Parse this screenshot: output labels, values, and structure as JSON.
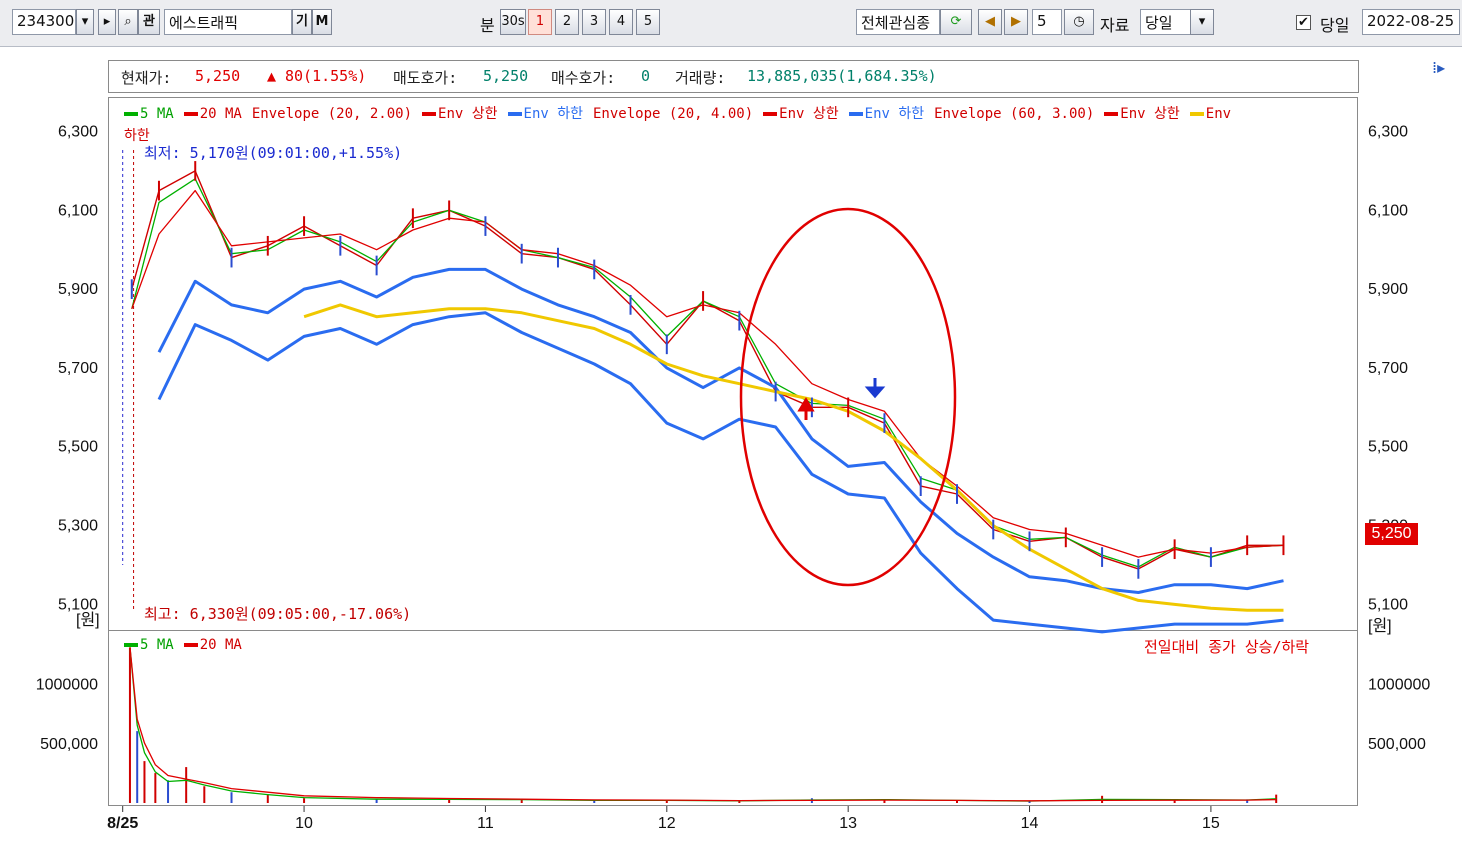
{
  "toolbar": {
    "code": "234300",
    "name": "에스트래픽",
    "ki_btn": "기",
    "m_btn": "M",
    "gwan_btn": "관",
    "bun_label": "분",
    "sec_btn": "30s",
    "periods": [
      "1",
      "2",
      "3",
      "4",
      "5"
    ],
    "watch_list": "전체관심종",
    "count": "5",
    "data_label": "자료",
    "range_select": "당일",
    "today_label": "당일",
    "date": "2022-08-25",
    "today_checked": true
  },
  "info": {
    "cur_label": "현재가:",
    "cur_price": "5,250",
    "change_arrow": "▲",
    "change": "80(1.55%)",
    "ask_label": "매도호가:",
    "ask": "5,250",
    "bid_label": "매수호가:",
    "bid": "0",
    "vol_label": "거래량:",
    "volume": "13,885,035(1,684.35%)"
  },
  "legend_price": [
    {
      "text": "5 MA",
      "color": "#00b000"
    },
    {
      "text": "20 MA",
      "color": "#e00000"
    },
    {
      "text": "Envelope (20, 2.00)",
      "color": "#d00000",
      "noswatch": true
    },
    {
      "text": "Env 상한",
      "color": "#e00000"
    },
    {
      "text": "Env 하한",
      "color": "#2a6cf0"
    },
    {
      "text": "Envelope (20, 4.00)",
      "color": "#d00000",
      "noswatch": true
    },
    {
      "text": "Env 상한",
      "color": "#e00000"
    },
    {
      "text": "Env 하한",
      "color": "#2a6cf0"
    },
    {
      "text": "Envelope (60, 3.00)",
      "color": "#d00000",
      "noswatch": true
    },
    {
      "text": "Env 상한",
      "color": "#e00000"
    },
    {
      "text": "Env 하한",
      "color": "#f0c800"
    }
  ],
  "annotations": {
    "low": "최저: 5,170원(09:01:00,+1.55%)",
    "high": "최고: 6,330원(09:05:00,-17.06%)",
    "volume_note": "전일대비 종가 상승/하락",
    "current_badge": "5,250",
    "unit": "[원]"
  },
  "legend_volume": [
    {
      "text": "5 MA",
      "color": "#00b000"
    },
    {
      "text": "20 MA",
      "color": "#e00000"
    }
  ],
  "chart_data": {
    "type": "line",
    "title": "",
    "x": [
      9.05,
      9.2,
      9.4,
      9.6,
      9.8,
      10.0,
      10.2,
      10.4,
      10.6,
      10.8,
      11.0,
      11.2,
      11.4,
      11.6,
      11.8,
      12.0,
      12.2,
      12.4,
      12.6,
      12.8,
      13.0,
      13.2,
      13.4,
      13.6,
      13.8,
      14.0,
      14.2,
      14.4,
      14.6,
      14.8,
      15.0,
      15.2,
      15.4
    ],
    "x_ticks": [
      "8/25",
      "10",
      "11",
      "12",
      "13",
      "14",
      "15"
    ],
    "x_tick_values": [
      9.0,
      10.0,
      11.0,
      12.0,
      13.0,
      14.0,
      15.0
    ],
    "xlim": [
      8.93,
      15.8
    ],
    "ylim": [
      5040,
      6380
    ],
    "y_ticks": [
      "6,300",
      "6,100",
      "5,900",
      "5,700",
      "5,500",
      "5,300",
      "5,100"
    ],
    "y_tick_values": [
      6300,
      6100,
      5900,
      5700,
      5500,
      5300,
      5100
    ],
    "series": [
      {
        "name": "Price",
        "color": "#d00000",
        "values": [
          5900,
          6150,
          6200,
          5980,
          6010,
          6060,
          6010,
          5960,
          6080,
          6100,
          6060,
          5990,
          5980,
          5950,
          5860,
          5760,
          5870,
          5820,
          5640,
          5600,
          5600,
          5560,
          5400,
          5380,
          5290,
          5260,
          5270,
          5220,
          5190,
          5240,
          5220,
          5250,
          5250
        ]
      },
      {
        "name": "5 MA",
        "color": "#00b000",
        "values": [
          5850,
          6120,
          6180,
          5990,
          6000,
          6050,
          6020,
          5970,
          6070,
          6100,
          6070,
          6000,
          5980,
          5955,
          5880,
          5780,
          5870,
          5830,
          5660,
          5610,
          5605,
          5570,
          5420,
          5390,
          5300,
          5265,
          5270,
          5225,
          5195,
          5245,
          5220,
          5245,
          5250
        ]
      },
      {
        "name": "20 MA",
        "color": "#e00000",
        "values": [
          5850,
          6040,
          6150,
          6010,
          6020,
          6030,
          6040,
          6000,
          6050,
          6080,
          6070,
          6000,
          5990,
          5960,
          5910,
          5830,
          5860,
          5840,
          5760,
          5660,
          5620,
          5590,
          5470,
          5400,
          5320,
          5290,
          5280,
          5250,
          5220,
          5240,
          5230,
          5245,
          5250
        ]
      },
      {
        "name": "Env 하한 (20, 2.00)",
        "color": "#2a6cf0",
        "values": [
          null,
          5740,
          5920,
          5860,
          5840,
          5900,
          5920,
          5880,
          5930,
          5950,
          5950,
          5900,
          5860,
          5830,
          5790,
          5700,
          5650,
          5700,
          5650,
          5520,
          5450,
          5460,
          5360,
          5280,
          5220,
          5170,
          5160,
          5140,
          5130,
          5150,
          5150,
          5140,
          5160
        ]
      },
      {
        "name": "Env 하한 (20, 4.00)",
        "color": "#2a6cf0",
        "values": [
          null,
          5620,
          5810,
          5770,
          5720,
          5780,
          5800,
          5760,
          5810,
          5830,
          5840,
          5790,
          5750,
          5710,
          5660,
          5560,
          5520,
          5570,
          5550,
          5430,
          5380,
          5370,
          5230,
          5140,
          5060,
          5050,
          5040,
          5030,
          5040,
          5050,
          5050,
          5050,
          5060
        ]
      },
      {
        "name": "Env 하한 (60, 3.00)",
        "color": "#f0c800",
        "values": [
          null,
          null,
          null,
          null,
          null,
          5830,
          5860,
          5830,
          5840,
          5850,
          5850,
          5840,
          5820,
          5800,
          5760,
          5710,
          5680,
          5660,
          5640,
          5620,
          5590,
          5540,
          5470,
          5390,
          5300,
          5240,
          5190,
          5140,
          5110,
          5100,
          5090,
          5085,
          5085
        ]
      }
    ],
    "volume": {
      "ylim": [
        0,
        1420000
      ],
      "y_ticks": [
        "1000000",
        "500,000"
      ],
      "y_tick_values": [
        1000000,
        500000
      ],
      "x": [
        9.04,
        9.08,
        9.12,
        9.18,
        9.25,
        9.35,
        9.45,
        9.6,
        9.8,
        10.0,
        10.4,
        10.8,
        11.2,
        11.6,
        12.0,
        12.4,
        12.8,
        13.2,
        13.6,
        14.0,
        14.4,
        14.8,
        15.2,
        15.36
      ],
      "values": [
        1300000,
        600000,
        350000,
        250000,
        190000,
        300000,
        140000,
        90000,
        70000,
        40000,
        30000,
        35000,
        25000,
        20000,
        25000,
        15000,
        40000,
        30000,
        20000,
        15000,
        60000,
        20000,
        30000,
        70000
      ],
      "ma5": [
        1300000,
        650000,
        420000,
        260000,
        180000,
        190000,
        150000,
        100000,
        70000,
        45000,
        32000,
        30000,
        28000,
        22000,
        22000,
        18000,
        25000,
        28000,
        22000,
        16000,
        30000,
        28000,
        25000,
        35000
      ],
      "ma20": [
        1300000,
        700000,
        500000,
        320000,
        230000,
        200000,
        170000,
        120000,
        90000,
        60000,
        45000,
        38000,
        32000,
        26000,
        24000,
        20000,
        22000,
        24000,
        22000,
        18000,
        22000,
        23000,
        24000,
        28000
      ]
    }
  }
}
